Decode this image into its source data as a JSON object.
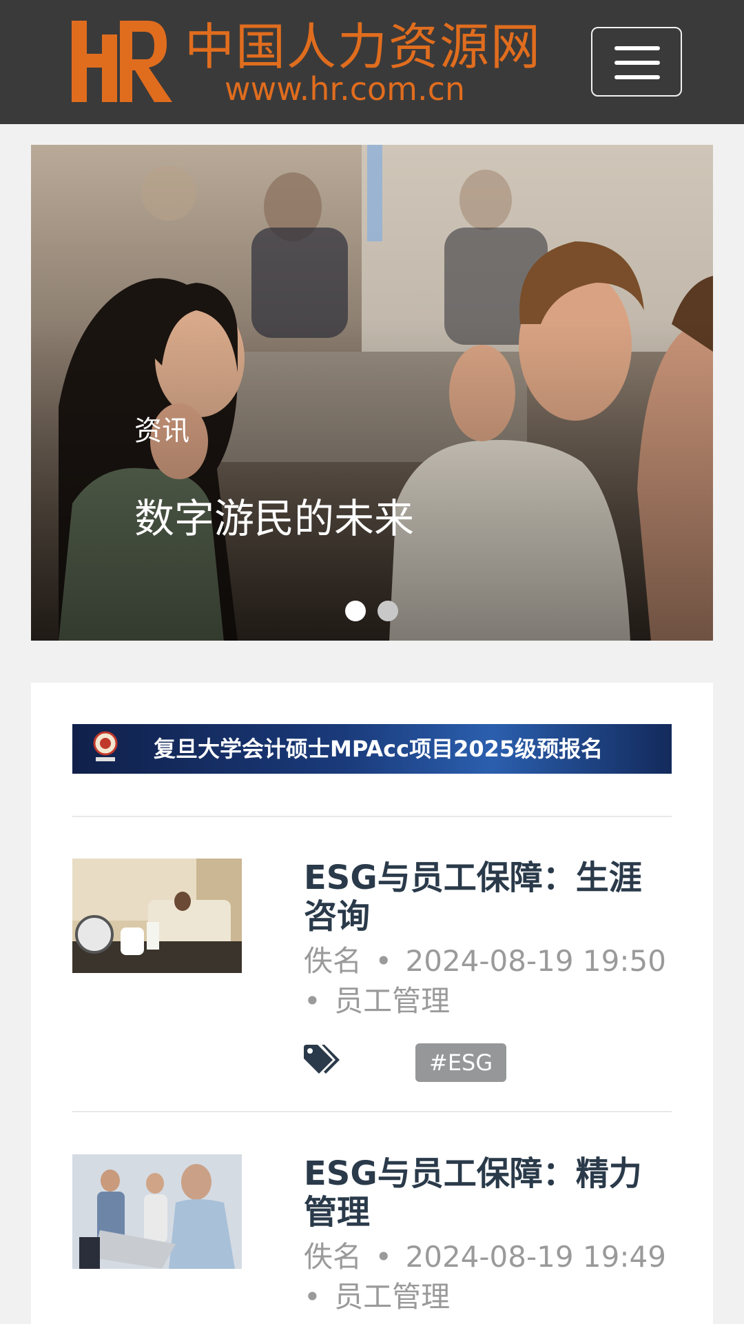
{
  "header": {
    "logo_cn": "中国人力资源网",
    "logo_url": "www.hr.com.cn",
    "logo_letters": "HR",
    "menu_icon": "hamburger-icon",
    "brand_color": "#e06d1e",
    "bg_color": "#3b3a3a"
  },
  "carousel": {
    "category": "资讯",
    "title": "数字游民的未来",
    "slide_count": 2,
    "active_slide": 1
  },
  "ad": {
    "text": "复旦大学会计硕士MPAcc项目2025级预报名"
  },
  "articles": [
    {
      "title": "ESG与员工保障：生涯咨询",
      "author": "佚名",
      "date": "2024-08-19 19:50",
      "category": "员工管理",
      "tag_icon": "tags-icon",
      "tags": [
        "#ESG"
      ]
    },
    {
      "title": "ESG与员工保障：精力管理",
      "author": "佚名",
      "date": "2024-08-19 19:49",
      "category": "员工管理"
    }
  ]
}
